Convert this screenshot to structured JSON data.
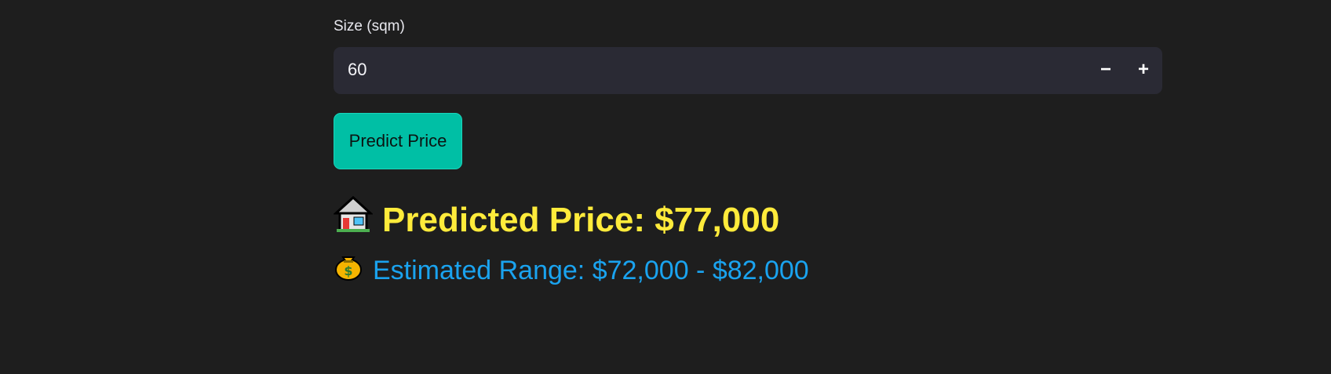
{
  "form": {
    "size_label": "Size (sqm)",
    "size_value": "60",
    "decrement_label": "−",
    "increment_label": "+",
    "predict_button_label": "Predict Price"
  },
  "result": {
    "price_text": "Predicted Price: $77,000",
    "range_text": "Estimated Range: $72,000 - $82,000",
    "price_icon": "house-icon",
    "range_icon": "money-bag-icon"
  },
  "colors": {
    "background": "#1e1e1e",
    "input_bg": "#2a2a34",
    "button_bg": "#00bfa5",
    "price_color": "#ffeb3b",
    "range_color": "#1aa3ef"
  }
}
